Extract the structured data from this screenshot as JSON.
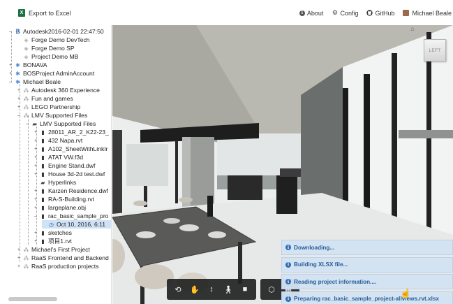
{
  "header": {
    "export_label": "Export to Excel",
    "export_icon": "excel-icon",
    "nav": [
      {
        "label": "About",
        "icon": "info-icon"
      },
      {
        "label": "Config",
        "icon": "gear-icon"
      },
      {
        "label": "GitHub",
        "icon": "github-icon"
      }
    ],
    "user_name": "Michael Beale"
  },
  "tree": {
    "items": [
      {
        "label": "Autodesk2016-02-01 22:47:50",
        "icon": "b360-icon"
      },
      {
        "label": "Forge Demo DevTech",
        "icon": "project-icon"
      },
      {
        "label": "Forge Demo SP",
        "icon": "project-icon"
      },
      {
        "label": "Project Demo MB",
        "icon": "project-icon"
      },
      {
        "label": "BONAVA",
        "icon": "hub-icon"
      },
      {
        "label": "BOSProject AdminAccount",
        "icon": "hub-icon"
      },
      {
        "label": "Michael Beale",
        "icon": "hub-icon"
      },
      {
        "label": "Autodesk 360 Experience",
        "icon": "project-icon"
      },
      {
        "label": "Fun and games",
        "icon": "project-icon"
      },
      {
        "label": "LEGO Partnership",
        "icon": "project-icon"
      },
      {
        "label": "LMV Supported Files",
        "icon": "project-icon"
      },
      {
        "label": "LMV Supported Files",
        "icon": "folder-icon"
      },
      {
        "label": "28011_AR_2_K22-23_",
        "icon": "file-icon"
      },
      {
        "label": "432 Napa.rvt",
        "icon": "file-icon"
      },
      {
        "label": "A102_SheetWithLinkIr",
        "icon": "file-icon"
      },
      {
        "label": "ATAT VW.f3d",
        "icon": "file-icon"
      },
      {
        "label": "Engine Stand.dwf",
        "icon": "file-icon"
      },
      {
        "label": "House 3d-2d test.dwf",
        "icon": "file-icon"
      },
      {
        "label": "Hyperlinks",
        "icon": "folder-icon"
      },
      {
        "label": "Karzen Residence.dwf",
        "icon": "file-icon"
      },
      {
        "label": "RA-S-Building.rvt",
        "icon": "file-icon"
      },
      {
        "label": "largeplane.obj",
        "icon": "file-icon"
      },
      {
        "label": "rac_basic_sample_pro",
        "icon": "file-icon"
      },
      {
        "label": "Oct 10, 2016, 6:11",
        "icon": "clock-icon"
      },
      {
        "label": "sketches",
        "icon": "file-icon"
      },
      {
        "label": "项目1.rvt",
        "icon": "file-icon"
      },
      {
        "label": "Michael's First Project",
        "icon": "project-icon"
      },
      {
        "label": "RaaS Frontend and Backend",
        "icon": "project-icon"
      },
      {
        "label": "RaaS production projects",
        "icon": "project-icon"
      }
    ]
  },
  "viewer": {
    "cube_label": "LEFT",
    "toolbar_nav": [
      "orbit-icon",
      "pan-icon",
      "zoom-icon",
      "first-person-icon",
      "camera-icon"
    ],
    "toolbar_tools": [
      "model-browser-icon",
      "explode-icon"
    ]
  },
  "notifications": [
    {
      "text": "Downloading..."
    },
    {
      "text": "Building XLSX file..."
    },
    {
      "text": "Reading project information...."
    },
    {
      "text": "Preparing rac_basic_sample_project-allviews.rvt.xlsx"
    }
  ],
  "colors": {
    "note_bg": "#d2e2f3",
    "note_text": "#2a5d98",
    "selected_row": "#cfe2f6",
    "toolbar_bg": "#222222"
  }
}
